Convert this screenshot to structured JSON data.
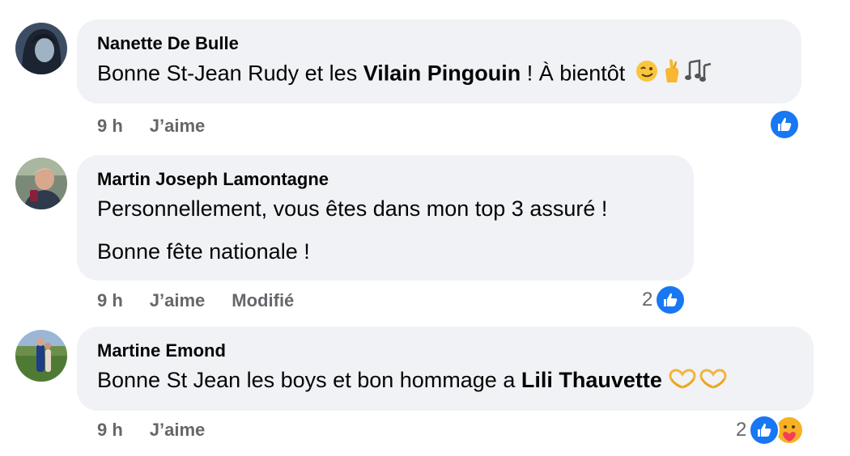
{
  "comments": [
    {
      "author": "Nanette De Bulle",
      "text_before": "Bonne St-Jean Rudy et les ",
      "mention": "Vilain Pingouin",
      "text_after": " ! À bientôt ",
      "emojis": [
        "winking-face-emoji",
        "crossed-fingers-emoji",
        "musical-notes-emoji"
      ],
      "time": "9 h",
      "like_label": "J’aime",
      "reactions": {
        "count": "",
        "types": [
          "like"
        ]
      }
    },
    {
      "author": "Martin Joseph Lamontagne",
      "line1": "Personnellement, vous êtes dans mon top 3 assuré !",
      "line2": "Bonne fête nationale !",
      "time": "9 h",
      "like_label": "J’aime",
      "edited_label": "Modifié",
      "reactions": {
        "count": "2",
        "types": [
          "like"
        ]
      }
    },
    {
      "author": "Martine Emond",
      "text_before": "Bonne St Jean les boys et bon hommage a ",
      "mention": "Lili Thauvette",
      "emojis": [
        "heart-hands-emoji",
        "heart-hands-emoji"
      ],
      "time": "9 h",
      "like_label": "J’aime",
      "reactions": {
        "count": "2",
        "types": [
          "like",
          "care"
        ]
      }
    }
  ],
  "colors": {
    "bubble": "#f0f2f5",
    "meta_text": "#65676b",
    "like_blue": "#1877f2",
    "care_yellow": "#f7b125"
  }
}
